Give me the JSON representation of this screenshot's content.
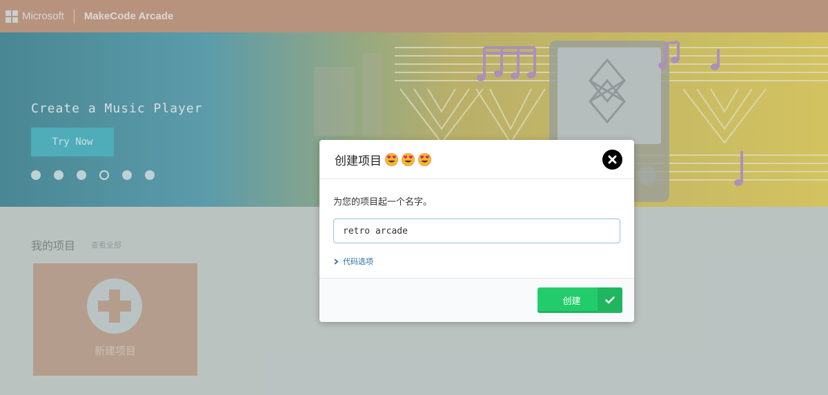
{
  "header": {
    "microsoft_label": "Microsoft",
    "app_name": "MakeCode Arcade"
  },
  "hero": {
    "title": "Create a Music Player",
    "cta_label": "Try Now",
    "carousel_dots": 6,
    "active_dot": 4
  },
  "projects": {
    "title": "我的项目",
    "view_all": "查看全部",
    "new_project_label": "新建项目"
  },
  "dialog": {
    "title": "创建项目",
    "title_emojis": [
      "heart-eyes-emoji",
      "heart-eyes-emoji",
      "heart-eyes-emoji"
    ],
    "prompt": "为您的项目起一个名字。",
    "name_value": "retro arcade",
    "code_options_label": "代码选项",
    "create_label": "创建"
  },
  "colors": {
    "topbar": "#b87d5b",
    "hero_teal": "#116a7e",
    "hero_yellow": "#e3c62e",
    "create_button": "#22cc6a",
    "input_border": "#8fc4d7"
  }
}
